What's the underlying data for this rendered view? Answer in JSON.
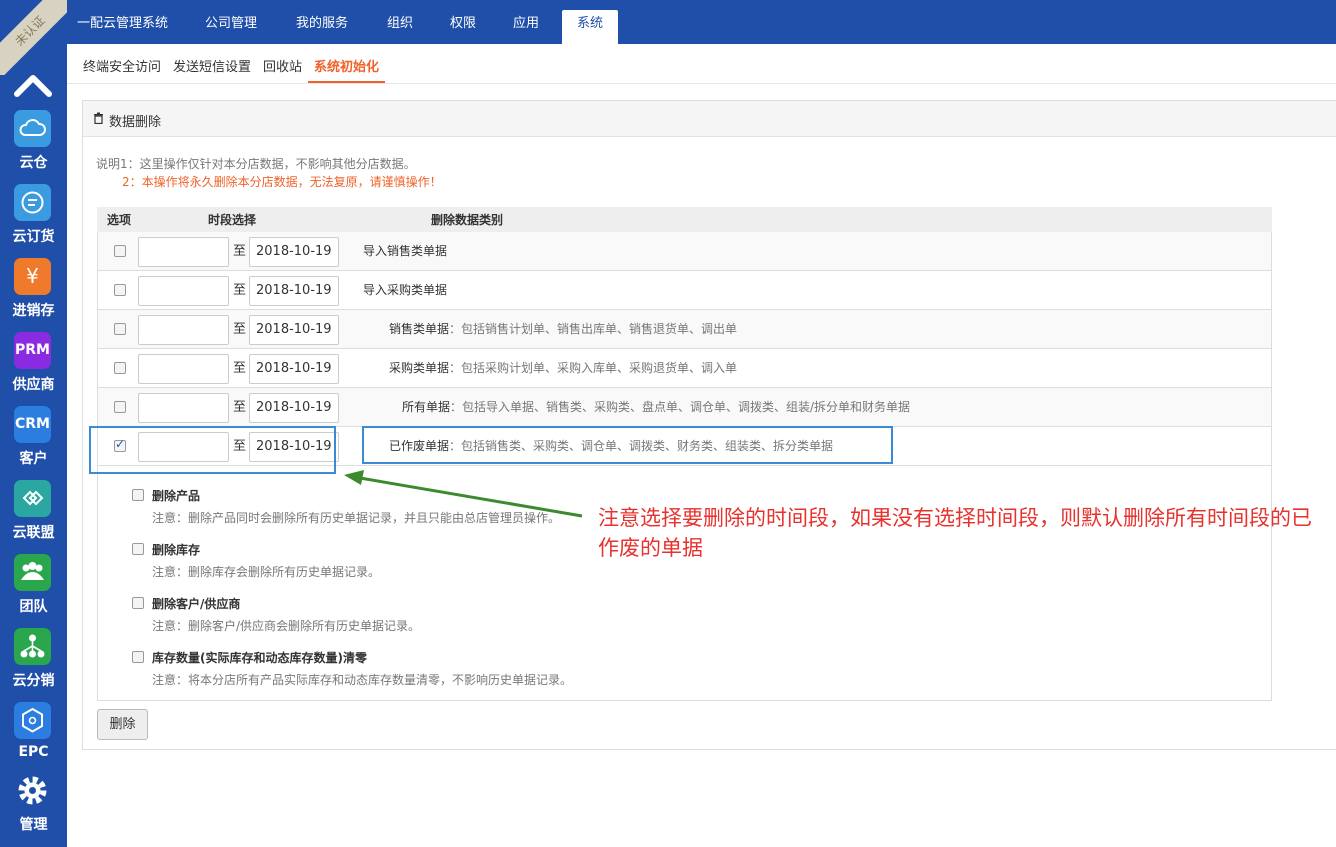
{
  "badge": "未认证",
  "sidebar": {
    "items": [
      {
        "label": "云仓",
        "icon": "cloud-icon",
        "color": "#3b9be0"
      },
      {
        "label": "云订货",
        "icon": "chat-icon",
        "color": "#3b9be0"
      },
      {
        "label": "进销存",
        "icon": "yen-icon",
        "color": "#f07a2c",
        "glyph": "¥"
      },
      {
        "label": "供应商",
        "icon": "prm-icon",
        "color": "#8a2be2",
        "glyph": "PRM"
      },
      {
        "label": "客户",
        "icon": "crm-icon",
        "color": "#2b7de0",
        "glyph": "CRM"
      },
      {
        "label": "云联盟",
        "icon": "handshake-icon",
        "color": "#2aa7a0"
      },
      {
        "label": "团队",
        "icon": "team-icon",
        "color": "#2aa74c"
      },
      {
        "label": "云分销",
        "icon": "network-icon",
        "color": "#2aa74c"
      },
      {
        "label": "EPC",
        "icon": "hexagon-icon",
        "color": "#2b7de0"
      },
      {
        "label": "管理",
        "icon": "gear-icon",
        "color": "#1f4fa8"
      }
    ]
  },
  "topnav": {
    "items": [
      "一配云管理系统",
      "公司管理",
      "我的服务",
      "组织",
      "权限",
      "应用",
      "系统"
    ],
    "active": "系统"
  },
  "subnav": {
    "items": [
      "终端安全访问",
      "发送短信设置",
      "回收站",
      "系统初始化"
    ],
    "active": "系统初始化"
  },
  "panel": {
    "title": "数据删除",
    "note1": "说明1：这里操作仅针对本分店数据，不影响其他分店数据。",
    "note2": "2：本操作将永久删除本分店数据，无法复原，请谨慎操作！"
  },
  "table": {
    "headers": [
      "选项",
      "时段选择",
      "删除数据类别"
    ],
    "separator": "至",
    "rows": [
      {
        "checked": false,
        "from": "",
        "to": "2018-10-19",
        "label": "导入销售类单据",
        "desc": ""
      },
      {
        "checked": false,
        "from": "",
        "to": "2018-10-19",
        "label": "导入采购类单据",
        "desc": ""
      },
      {
        "checked": false,
        "from": "",
        "to": "2018-10-19",
        "label": "销售类单据",
        "desc": "：包括销售计划单、销售出库单、销售退货单、调出单"
      },
      {
        "checked": false,
        "from": "",
        "to": "2018-10-19",
        "label": "采购类单据",
        "desc": "：包括采购计划单、采购入库单、采购退货单、调入单"
      },
      {
        "checked": false,
        "from": "",
        "to": "2018-10-19",
        "label": "所有单据",
        "desc": "：包括导入单据、销售类、采购类、盘点单、调仓单、调拨类、组装/拆分单和财务单据"
      },
      {
        "checked": true,
        "from": "",
        "to": "2018-10-19",
        "label": "已作废单据",
        "desc": "：包括销售类、采购类、调仓单、调拨类、财务类、组装类、拆分类单据"
      }
    ]
  },
  "options": [
    {
      "title": "删除产品",
      "note": "注意：删除产品同时会删除所有历史单据记录，并且只能由总店管理员操作。"
    },
    {
      "title": "删除库存",
      "note": "注意：删除库存会删除所有历史单据记录。"
    },
    {
      "title": "删除客户/供应商",
      "note": "注意：删除客户/供应商会删除所有历史单据记录。"
    },
    {
      "title": "库存数量(实际库存和动态库存数量)清零",
      "note": "注意：将本分店所有产品实际库存和动态库存数量清零，不影响历史单据记录。"
    }
  ],
  "delete_button": "删除",
  "annotation": "注意选择要删除的时间段，如果没有选择时间段，则默认删除所有时间段的已作废的单据"
}
